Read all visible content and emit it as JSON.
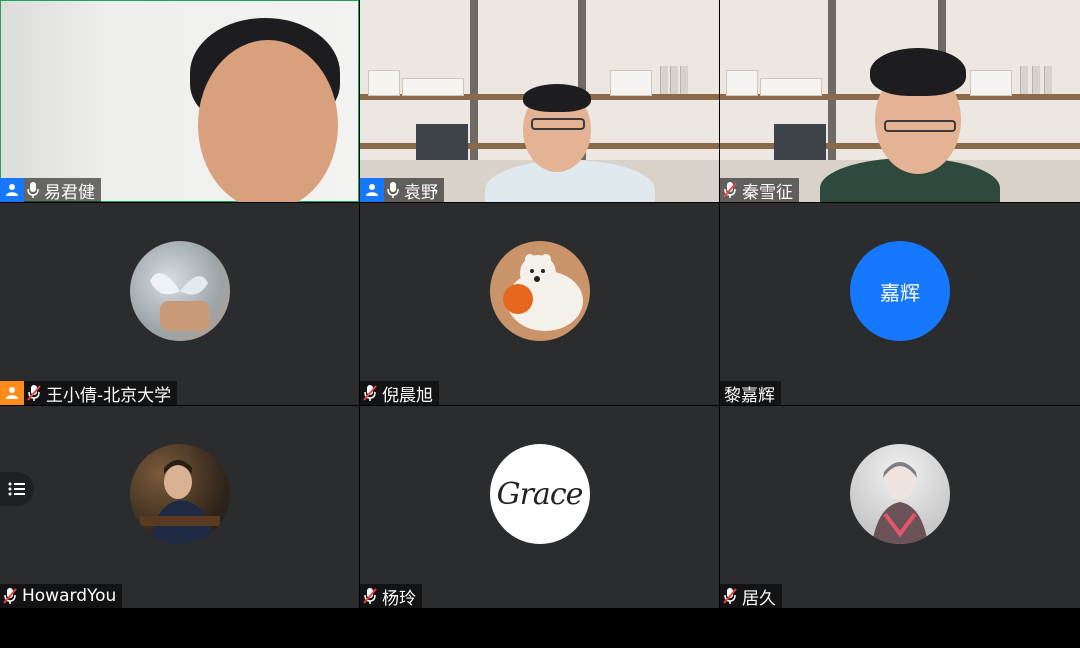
{
  "participants": [
    {
      "name": "易君健",
      "badge": "blue",
      "mic": "on",
      "kind": "video"
    },
    {
      "name": "袁野",
      "badge": "blue",
      "mic": "on",
      "kind": "video"
    },
    {
      "name": "秦雪征",
      "badge": "none",
      "mic": "muted",
      "kind": "video"
    },
    {
      "name": "王小倩-北京大学",
      "badge": "orange",
      "mic": "muted",
      "kind": "avatar"
    },
    {
      "name": "倪晨旭",
      "badge": "none",
      "mic": "muted",
      "kind": "avatar"
    },
    {
      "name": "黎嘉辉",
      "badge": "none",
      "mic": "none",
      "kind": "avatar",
      "avatar_text": "嘉辉"
    },
    {
      "name": "HowardYou",
      "badge": "none",
      "mic": "muted",
      "kind": "avatar"
    },
    {
      "name": "杨玲",
      "badge": "none",
      "mic": "muted",
      "kind": "avatar",
      "avatar_text": "Grace"
    },
    {
      "name": "居久",
      "badge": "none",
      "mic": "muted",
      "kind": "avatar"
    }
  ],
  "colors": {
    "active_speaker_border": "#1fa35a",
    "badge_blue": "#1677ff",
    "badge_orange": "#ff8c1a",
    "mute_red": "#e54545",
    "tile_bg": "#2b2c2e"
  },
  "icons": {
    "list_toggle": "list-icon",
    "mic_on": "microphone-icon",
    "mic_muted": "microphone-muted-icon",
    "person": "person-icon"
  }
}
